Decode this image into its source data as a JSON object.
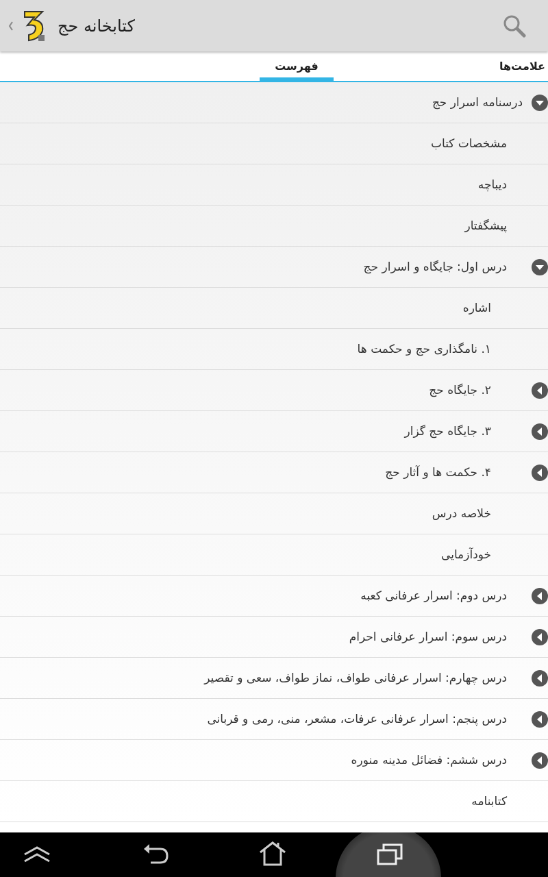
{
  "action_bar": {
    "title": "کتابخانه حج"
  },
  "tabs": [
    {
      "label": "علامت‌ها",
      "selected": false
    },
    {
      "label": "فهرست",
      "selected": true
    }
  ],
  "toc": [
    {
      "label": "درسنامه اسرار حج",
      "expanded": true,
      "children": [
        {
          "label": "مشخصات کتاب"
        },
        {
          "label": "دیباچه"
        },
        {
          "label": "پیشگفتار"
        },
        {
          "label": "درس اول: جایگاه و اسرار حج",
          "expanded": true,
          "children": [
            {
              "label": "اشاره"
            },
            {
              "label": "۱. نامگذاری حج و حکمت ها"
            },
            {
              "label": "۲. جایگاه حج",
              "expanded": false
            },
            {
              "label": "۳. جایگاه حج گزار",
              "expanded": false
            },
            {
              "label": "۴. حکمت ها و آثار حج",
              "expanded": false
            },
            {
              "label": "خلاصه درس"
            },
            {
              "label": "خودآزمایی"
            }
          ]
        },
        {
          "label": "درس دوم: اسرار عرفانی کعبه",
          "expanded": false
        },
        {
          "label": "درس سوم: اسرار عرفانی احرام",
          "expanded": false
        },
        {
          "label": "درس چهارم: اسرار عرفانی طواف، نماز طواف، سعی و تقصیر",
          "expanded": false
        },
        {
          "label": "درس پنجم: اسرار عرفانی عرفات، مشعر، منی، رمی و قربانی",
          "expanded": false
        },
        {
          "label": "درس ششم: فضائل مدینه منوره",
          "expanded": false
        },
        {
          "label": "کتابنامه"
        }
      ]
    }
  ]
}
